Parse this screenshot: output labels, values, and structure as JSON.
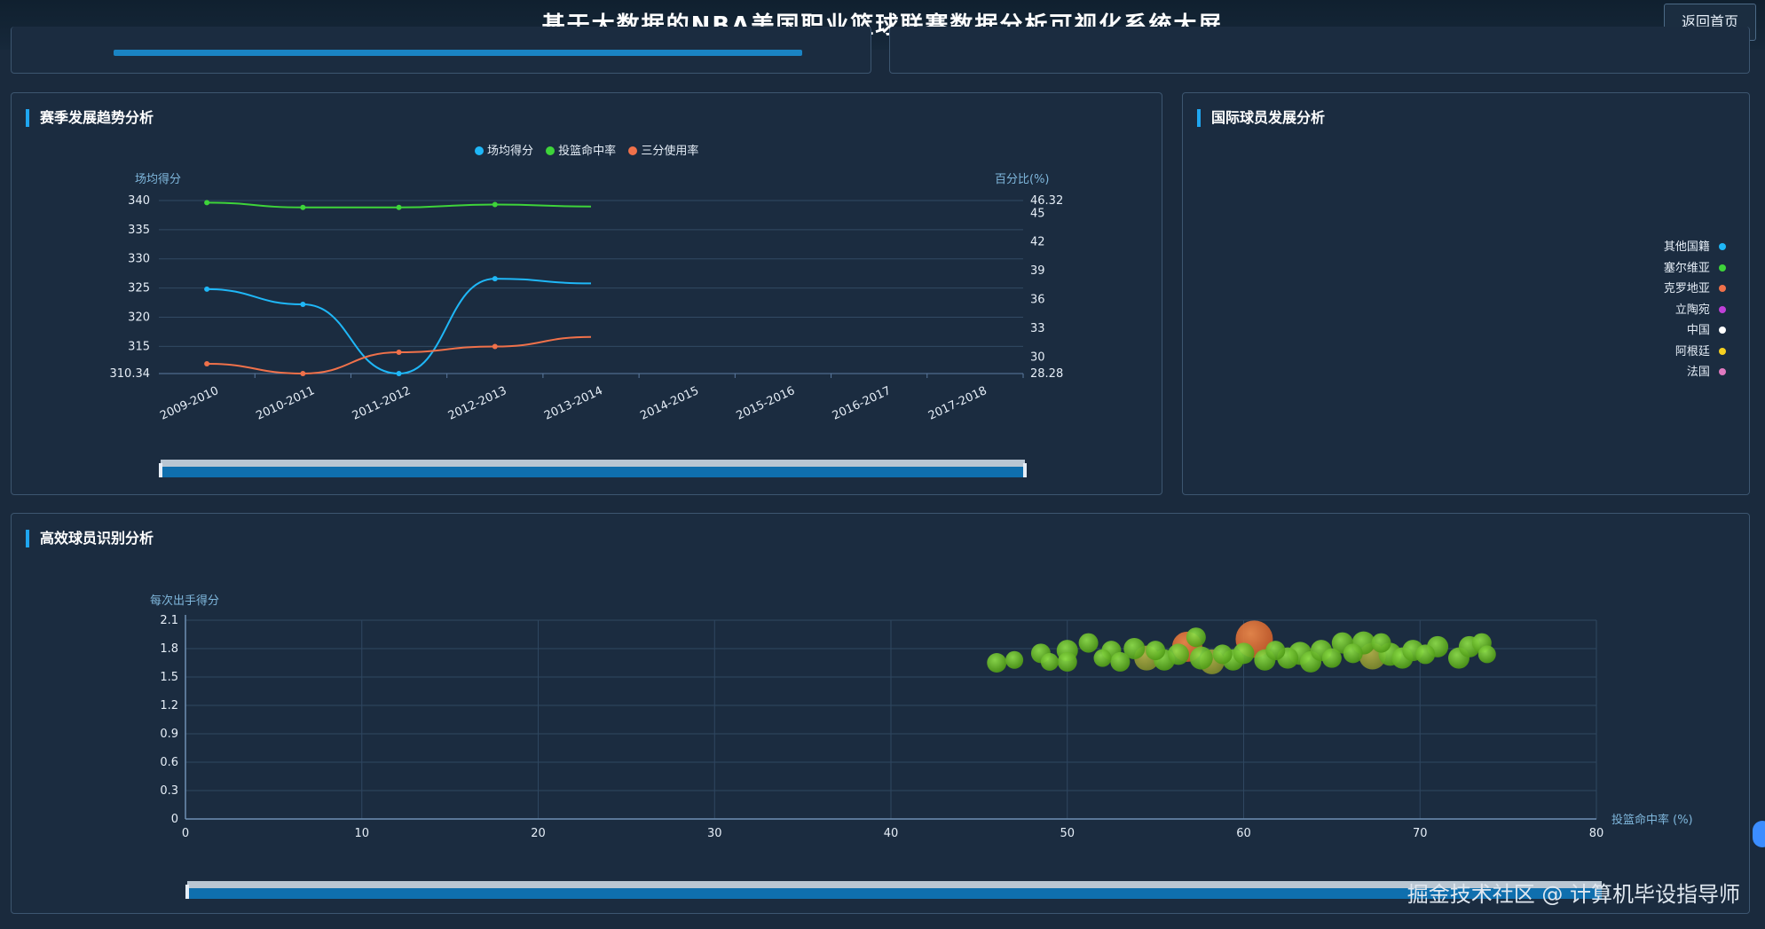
{
  "header": {
    "title": "基于大数据的NBA美国职业篮球联赛数据分析可视化系统大屏",
    "home_button": "返回首页"
  },
  "panels": {
    "season_trend": {
      "title": "赛季发展趋势分析",
      "legend": [
        {
          "name": "场均得分",
          "color": "#1fb7f7"
        },
        {
          "name": "投篮命中率",
          "color": "#3ed43a"
        },
        {
          "name": "三分使用率",
          "color": "#f0714a"
        }
      ],
      "left_axis_name": "场均得分",
      "right_axis_name": "百分比(%)",
      "left_ticks": [
        "340",
        "335",
        "330",
        "325",
        "320",
        "315",
        "310.34"
      ],
      "right_ticks": [
        "46.32",
        "45",
        "42",
        "39",
        "36",
        "33",
        "30",
        "28.28"
      ]
    },
    "international": {
      "title": "国际球员发展分析",
      "legend": [
        {
          "name": "其他国籍",
          "color": "#1fb7f7"
        },
        {
          "name": "塞尔维亚",
          "color": "#3ed43a"
        },
        {
          "name": "克罗地亚",
          "color": "#f0714a"
        },
        {
          "name": "立陶宛",
          "color": "#c040d8"
        },
        {
          "name": "中国",
          "color": "#ffffff"
        },
        {
          "name": "阿根廷",
          "color": "#f5d020"
        },
        {
          "name": "法国",
          "color": "#e07ac0"
        }
      ]
    },
    "efficient": {
      "title": "高效球员识别分析",
      "y_axis_name": "每次出手得分",
      "x_axis_name": "投篮命中率 (%)"
    }
  },
  "chart_data": [
    {
      "type": "line",
      "title": "赛季发展趋势分析",
      "categories": [
        "2009-2010",
        "2010-2011",
        "2011-2012",
        "2012-2013",
        "2013-2014",
        "2014-2015",
        "2015-2016",
        "2016-2017",
        "2017-2018"
      ],
      "ylabel": "场均得分",
      "ylabel_right": "百分比(%)",
      "ylim": [
        310.34,
        340
      ],
      "ylim_right": [
        28.28,
        46.32
      ],
      "series": [
        {
          "name": "场均得分",
          "axis": "left",
          "color": "#1fb7f7",
          "values": [
            324.8,
            322.2,
            310.34,
            326.6,
            null
          ]
        },
        {
          "name": "投篮命中率",
          "axis": "right",
          "color": "#3ed43a",
          "values": [
            46.1,
            45.6,
            45.6,
            45.9,
            null
          ]
        },
        {
          "name": "三分使用率",
          "axis": "right",
          "color": "#f0714a",
          "values": [
            29.3,
            28.28,
            30.5,
            31.1,
            null
          ]
        }
      ],
      "tail_values": {
        "场均得分": 325.8,
        "投篮命中率": 45.7,
        "三分使用率": 32.1
      },
      "legend_position": "top-center",
      "grid": true
    },
    {
      "type": "scatter",
      "title": "高效球员识别分析",
      "xlabel": "投篮命中率 (%)",
      "ylabel": "每次出手得分",
      "xlim": [
        0,
        80
      ],
      "ylim": [
        0,
        2.1
      ],
      "x_ticks": [
        "0",
        "10",
        "20",
        "30",
        "40",
        "50",
        "60",
        "70",
        "80"
      ],
      "y_ticks": [
        "0",
        "0.3",
        "0.6",
        "0.9",
        "1.2",
        "1.5",
        "1.8",
        "2.1"
      ],
      "points": [
        {
          "x": 46.0,
          "y": 1.65,
          "r": 11,
          "c": "green"
        },
        {
          "x": 47.0,
          "y": 1.68,
          "r": 10,
          "c": "green"
        },
        {
          "x": 48.5,
          "y": 1.75,
          "r": 11,
          "c": "green"
        },
        {
          "x": 49.0,
          "y": 1.66,
          "r": 10,
          "c": "green"
        },
        {
          "x": 50.0,
          "y": 1.78,
          "r": 12,
          "c": "green"
        },
        {
          "x": 50.0,
          "y": 1.66,
          "r": 11,
          "c": "green"
        },
        {
          "x": 51.2,
          "y": 1.86,
          "r": 11,
          "c": "green"
        },
        {
          "x": 52.0,
          "y": 1.7,
          "r": 10,
          "c": "green"
        },
        {
          "x": 52.5,
          "y": 1.78,
          "r": 11,
          "c": "green"
        },
        {
          "x": 53.0,
          "y": 1.66,
          "r": 11,
          "c": "green"
        },
        {
          "x": 53.8,
          "y": 1.8,
          "r": 12,
          "c": "green"
        },
        {
          "x": 54.5,
          "y": 1.7,
          "r": 14,
          "c": "olive"
        },
        {
          "x": 55.0,
          "y": 1.78,
          "r": 11,
          "c": "green"
        },
        {
          "x": 55.5,
          "y": 1.68,
          "r": 12,
          "c": "green"
        },
        {
          "x": 56.3,
          "y": 1.74,
          "r": 12,
          "c": "green"
        },
        {
          "x": 56.8,
          "y": 1.82,
          "r": 17,
          "c": "orange"
        },
        {
          "x": 57.3,
          "y": 1.92,
          "r": 11,
          "c": "green"
        },
        {
          "x": 57.6,
          "y": 1.7,
          "r": 13,
          "c": "green"
        },
        {
          "x": 58.2,
          "y": 1.66,
          "r": 14,
          "c": "olive"
        },
        {
          "x": 58.8,
          "y": 1.74,
          "r": 11,
          "c": "green"
        },
        {
          "x": 59.4,
          "y": 1.68,
          "r": 12,
          "c": "green"
        },
        {
          "x": 60.0,
          "y": 1.75,
          "r": 12,
          "c": "green"
        },
        {
          "x": 60.6,
          "y": 1.9,
          "r": 21,
          "c": "orange"
        },
        {
          "x": 61.2,
          "y": 1.68,
          "r": 12,
          "c": "green"
        },
        {
          "x": 61.8,
          "y": 1.78,
          "r": 11,
          "c": "green"
        },
        {
          "x": 62.5,
          "y": 1.7,
          "r": 12,
          "c": "green"
        },
        {
          "x": 63.2,
          "y": 1.75,
          "r": 13,
          "c": "green"
        },
        {
          "x": 63.8,
          "y": 1.66,
          "r": 12,
          "c": "green"
        },
        {
          "x": 64.4,
          "y": 1.78,
          "r": 12,
          "c": "green"
        },
        {
          "x": 65.0,
          "y": 1.7,
          "r": 11,
          "c": "green"
        },
        {
          "x": 65.6,
          "y": 1.86,
          "r": 12,
          "c": "green"
        },
        {
          "x": 66.2,
          "y": 1.75,
          "r": 11,
          "c": "green"
        },
        {
          "x": 66.8,
          "y": 1.86,
          "r": 13,
          "c": "green"
        },
        {
          "x": 67.3,
          "y": 1.72,
          "r": 15,
          "c": "olive"
        },
        {
          "x": 67.8,
          "y": 1.86,
          "r": 11,
          "c": "green"
        },
        {
          "x": 68.3,
          "y": 1.74,
          "r": 13,
          "c": "green"
        },
        {
          "x": 69.0,
          "y": 1.7,
          "r": 12,
          "c": "green"
        },
        {
          "x": 69.6,
          "y": 1.78,
          "r": 12,
          "c": "green"
        },
        {
          "x": 70.3,
          "y": 1.74,
          "r": 11,
          "c": "green"
        },
        {
          "x": 71.0,
          "y": 1.82,
          "r": 12,
          "c": "green"
        },
        {
          "x": 72.2,
          "y": 1.7,
          "r": 12,
          "c": "green"
        },
        {
          "x": 72.8,
          "y": 1.82,
          "r": 12,
          "c": "green"
        },
        {
          "x": 73.5,
          "y": 1.86,
          "r": 11,
          "c": "green"
        },
        {
          "x": 73.8,
          "y": 1.74,
          "r": 10,
          "c": "green"
        }
      ],
      "grid": true
    }
  ],
  "watermark": "掘金技术社区 @ 计算机毕设指导师"
}
